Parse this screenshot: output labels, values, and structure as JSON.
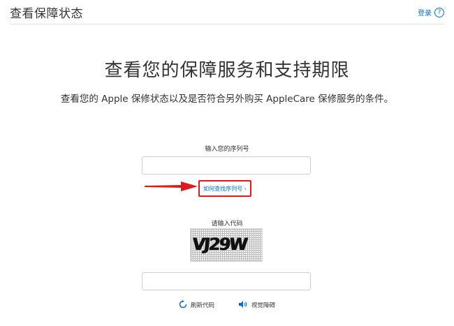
{
  "header": {
    "title": "查看保障状态",
    "login_label": "登录",
    "help_glyph": "?"
  },
  "main": {
    "heading": "查看您的保障服务和支持期限",
    "description": "查看您的 Apple 保修状态以及是否符合另外购买 AppleCare 保修服务的条件。"
  },
  "serial": {
    "label": "输入您的序列号",
    "value": "",
    "placeholder": "",
    "find_link": "如何查找序列号 ›"
  },
  "captcha": {
    "label": "请输入代码",
    "image_text": "VJ29W",
    "value": "",
    "placeholder": ""
  },
  "actions": {
    "refresh_label": "刷新代码",
    "audio_label": "视觉障碍"
  },
  "colors": {
    "link": "#0070c9",
    "annotation": "#e01a1a",
    "text": "#333333",
    "border": "#cccccc"
  },
  "icons": {
    "help": "question-circle-icon",
    "refresh": "refresh-icon",
    "audio": "speaker-icon",
    "arrow": "red-arrow-icon"
  }
}
